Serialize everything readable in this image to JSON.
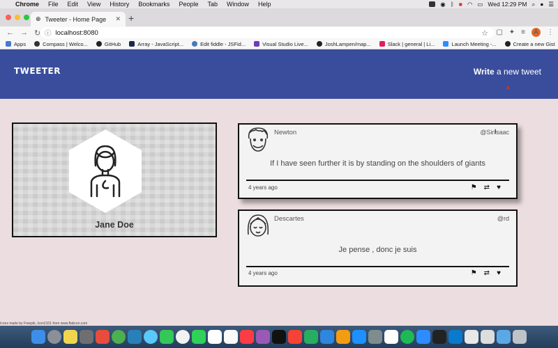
{
  "menubar": {
    "app": "Chrome",
    "items": [
      "File",
      "Edit",
      "View",
      "History",
      "Bookmarks",
      "People",
      "Tab",
      "Window",
      "Help"
    ],
    "clock": "Wed 12:29 PM"
  },
  "browser": {
    "tab_title": "Tweeter - Home Page",
    "url": "localhost:8080",
    "profile_initial": "A",
    "bookmarks": [
      "Apps",
      "Compass | Welco...",
      "GitHub",
      "Array - JavaScript...",
      "Edit fiddle - JSFid...",
      "Visual Studio Live...",
      "JoshLampen/map...",
      "Slack | general | Li...",
      "Launch Meeting -...",
      "Create a new Gist"
    ]
  },
  "header": {
    "logo": "TWEETER",
    "write_bold": "Write",
    "write_rest": " a new tweet"
  },
  "profile": {
    "name": "Jane Doe"
  },
  "tweets": [
    {
      "name": "Newton",
      "handle": "@SirIsaac",
      "content": "If I have seen further it is by standing on the shoulders of giants",
      "date": "4 years ago"
    },
    {
      "name": "Descartes",
      "handle": "@rd",
      "content": "Je pense , donc je suis",
      "date": "4 years ago"
    }
  ],
  "footer": {
    "credit": "Icons made by Freepik, Icon2101 from www.flaticon.com"
  },
  "colors": {
    "header": "#3a4d9c",
    "background": "#ecdde0",
    "card": "#f3f3f3"
  }
}
